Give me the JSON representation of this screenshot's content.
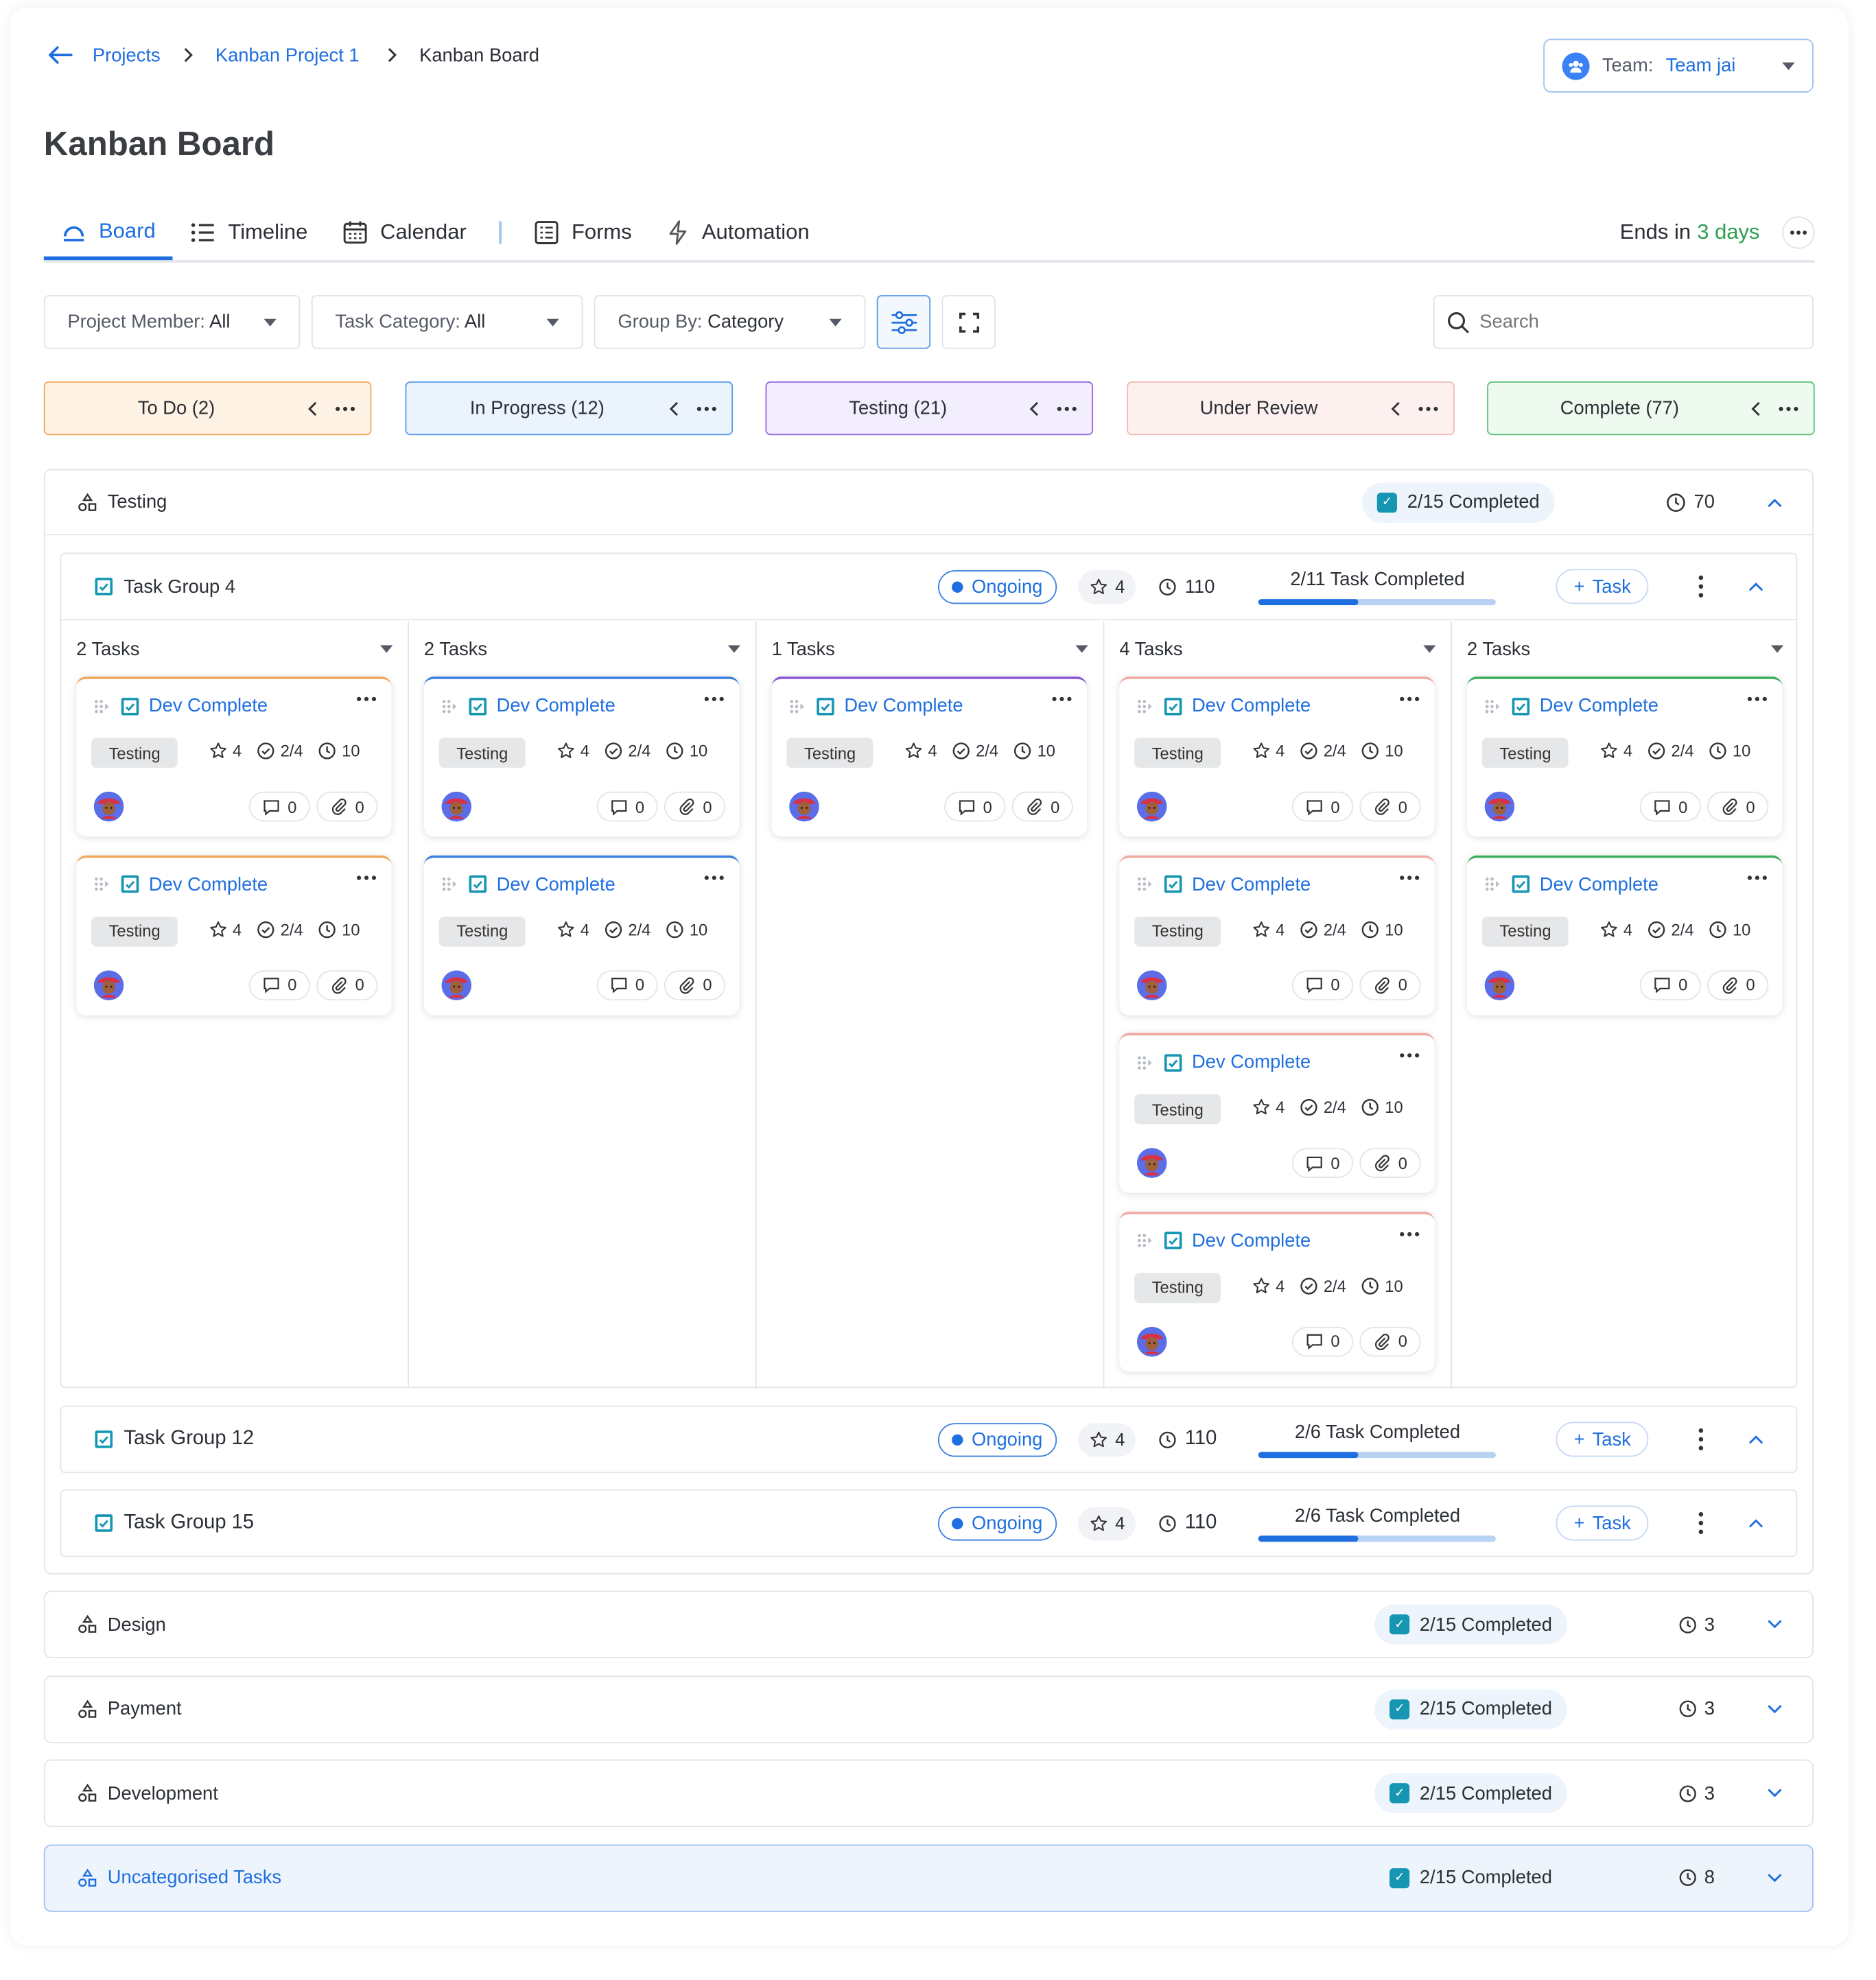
{
  "breadcrumb": {
    "projects": "Projects",
    "project": "Kanban Project 1",
    "current": "Kanban Board"
  },
  "team": {
    "label": "Team:",
    "value": "Team jai"
  },
  "page_title": "Kanban Board",
  "tabs": [
    {
      "label": "Board",
      "icon": "board-icon"
    },
    {
      "label": "Timeline",
      "icon": "timeline-icon"
    },
    {
      "label": "Calendar",
      "icon": "calendar-icon"
    },
    {
      "label": "Forms",
      "icon": "forms-icon"
    },
    {
      "label": "Automation",
      "icon": "lightning-icon"
    }
  ],
  "ends": {
    "prefix": "Ends in",
    "value": "3 days"
  },
  "filters": {
    "member": {
      "label": "Project Member:",
      "value": "All"
    },
    "category": {
      "label": "Task Category:",
      "value": "All"
    },
    "group_by": {
      "label": "Group By:",
      "value": "Category"
    }
  },
  "search": {
    "placeholder": "Search"
  },
  "status_columns": [
    {
      "name": "To Do (2)",
      "bg": "#fff3e6",
      "border": "#f2a65a"
    },
    {
      "name": "In Progress (12)",
      "bg": "#ebf3fd",
      "border": "#5b9be8"
    },
    {
      "name": "Testing (21)",
      "bg": "#f3eefe",
      "border": "#9467d8"
    },
    {
      "name": "Under Review",
      "bg": "#fdf1f0",
      "border": "#f1b9b3"
    },
    {
      "name": "Complete (77)",
      "bg": "#eef9f0",
      "border": "#5cc07a"
    }
  ],
  "testing_section": {
    "name": "Testing",
    "completed": "2/15 Completed",
    "time": "70",
    "group4": {
      "name": "Task Group 4",
      "status": "Ongoing",
      "stars": "4",
      "time": "110",
      "progress_text": "2/11 Task Completed",
      "progress": 0.42,
      "add": "Task",
      "columns": [
        {
          "count": "2 Tasks",
          "cards": 2,
          "color": "#f2a65a"
        },
        {
          "count": "2 Tasks",
          "cards": 2,
          "color": "#3a7fe0"
        },
        {
          "count": "1 Tasks",
          "cards": 1,
          "color": "#8a55d6"
        },
        {
          "count": "4 Tasks",
          "cards": 4,
          "color": "#f1a8a1"
        },
        {
          "count": "2 Tasks",
          "cards": 2,
          "color": "#3aae5c"
        }
      ]
    },
    "group12": {
      "name": "Task Group 12",
      "status": "Ongoing",
      "stars": "4",
      "time": "110",
      "progress_text": "2/6 Task Completed",
      "progress": 0.42,
      "add": "Task"
    },
    "group15": {
      "name": "Task Group 15",
      "status": "Ongoing",
      "stars": "4",
      "time": "110",
      "progress_text": "2/6 Task Completed",
      "progress": 0.42,
      "add": "Task"
    }
  },
  "card": {
    "title": "Dev Complete",
    "tag": "Testing",
    "stars": "4",
    "checks": "2/4",
    "time": "10",
    "comments": "0",
    "attachments": "0"
  },
  "collapsed_sections": [
    {
      "name": "Design",
      "completed": "2/15 Completed",
      "time": "3"
    },
    {
      "name": "Payment",
      "completed": "2/15 Completed",
      "time": "3"
    },
    {
      "name": "Development",
      "completed": "2/15 Completed",
      "time": "3"
    },
    {
      "name": "Uncategorised Tasks",
      "completed": "2/15 Completed",
      "time": "8"
    }
  ]
}
